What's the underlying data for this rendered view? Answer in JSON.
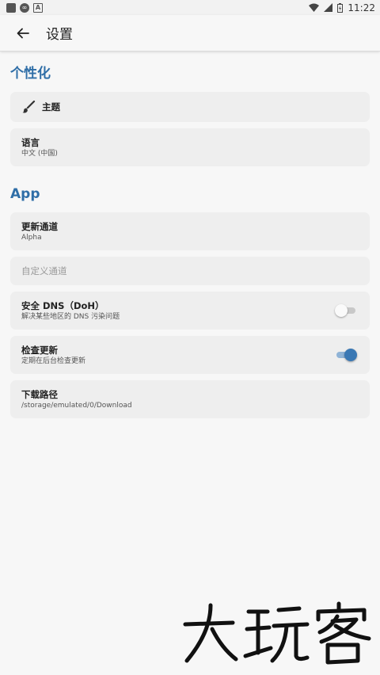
{
  "status_bar": {
    "time": "11:22"
  },
  "app_bar": {
    "title": "设置",
    "back_icon": "arrow-left-icon"
  },
  "sections": {
    "personalize": {
      "title": "个性化",
      "theme": {
        "title": "主题",
        "icon": "brush-icon"
      },
      "language": {
        "title": "语言",
        "value": "中文 (中国)"
      }
    },
    "app": {
      "title": "App",
      "update_channel": {
        "title": "更新通道",
        "value": "Alpha"
      },
      "custom_channel": {
        "placeholder": "自定义通道"
      },
      "secure_dns": {
        "title": "安全 DNS（DoH）",
        "subtitle": "解决某些地区的 DNS 污染问题",
        "enabled": false
      },
      "check_updates": {
        "title": "检查更新",
        "subtitle": "定期在后台检查更新",
        "enabled": true
      },
      "download_path": {
        "title": "下载路径",
        "value": "/storage/emulated/0/Download"
      }
    }
  },
  "colors": {
    "accent": "#2f6ea7",
    "toggle_on": "#3a78b4",
    "card_bg": "#eeeeee"
  },
  "watermark_logo": "大玩客"
}
